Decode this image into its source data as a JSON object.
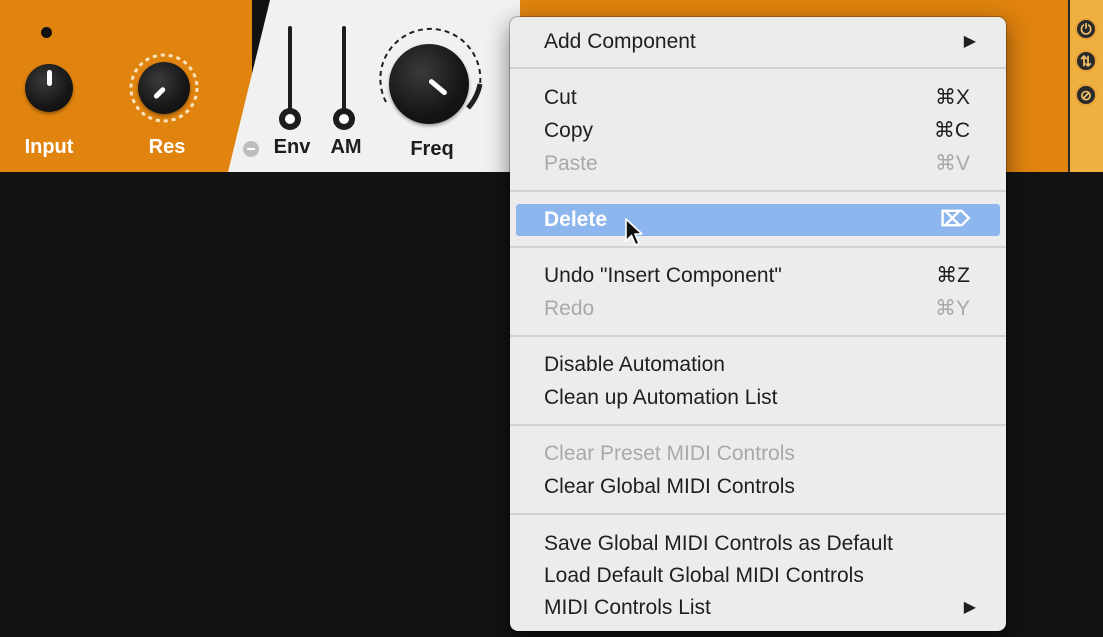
{
  "device_panel": {
    "controls": {
      "input_label": "Input",
      "res_label": "Res",
      "env_label": "Env",
      "am_label": "AM",
      "freq_label": "Freq"
    },
    "colors": {
      "orange": "#e0830f",
      "white_segment": "#f1f1f1",
      "background": "#121212"
    },
    "side_icons": [
      "power-icon",
      "swap-icon",
      "disable-icon"
    ]
  },
  "context_menu": {
    "highlight_color": "#8eb6ee",
    "items": [
      {
        "label": "Add Component",
        "shortcut": "",
        "submenu_arrow": "▶",
        "enabled": true
      },
      {
        "label": "Cut",
        "shortcut": "⌘X",
        "enabled": true
      },
      {
        "label": "Copy",
        "shortcut": "⌘C",
        "enabled": true
      },
      {
        "label": "Paste",
        "shortcut": "⌘V",
        "enabled": false
      },
      {
        "label": "Delete",
        "shortcut": "⌦",
        "enabled": true,
        "highlighted": true
      },
      {
        "label": "Undo \"Insert Component\"",
        "shortcut": "⌘Z",
        "enabled": true
      },
      {
        "label": "Redo",
        "shortcut": "⌘Y",
        "enabled": false
      },
      {
        "label": "Disable Automation",
        "shortcut": "",
        "enabled": true
      },
      {
        "label": "Clean up Automation List",
        "shortcut": "",
        "enabled": true
      },
      {
        "label": "Clear Preset MIDI Controls",
        "shortcut": "",
        "enabled": false
      },
      {
        "label": "Clear Global MIDI Controls",
        "shortcut": "",
        "enabled": true
      },
      {
        "label": "Save Global MIDI Controls as Default",
        "shortcut": "",
        "enabled": true
      },
      {
        "label": "Load Default Global MIDI Controls",
        "shortcut": "",
        "enabled": true
      },
      {
        "label": "MIDI Controls List",
        "shortcut": "",
        "submenu_arrow": "▶",
        "enabled": true
      }
    ]
  }
}
